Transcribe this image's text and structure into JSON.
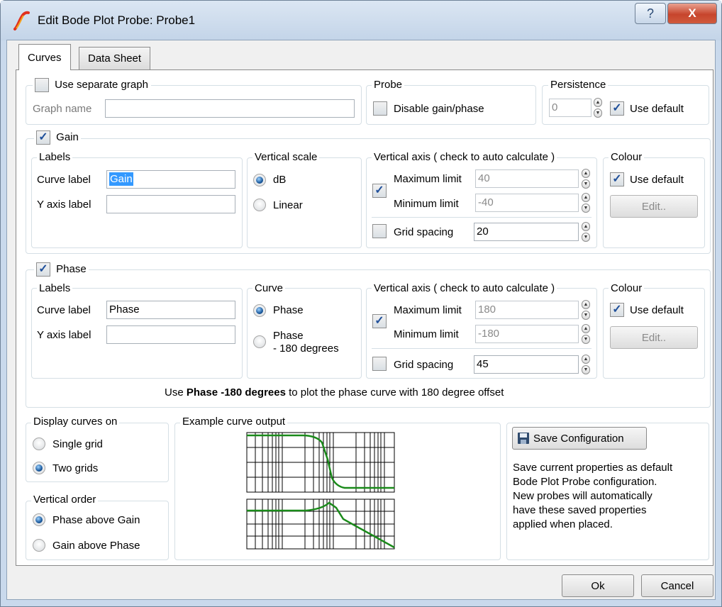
{
  "window": {
    "title": "Edit Bode Plot Probe: Probe1",
    "help_glyph": "?",
    "close_glyph": "X"
  },
  "tabs": [
    {
      "label": "Curves"
    },
    {
      "label": "Data Sheet"
    }
  ],
  "top": {
    "separate_graph": {
      "label": "Use separate graph",
      "checked": false
    },
    "graph_name": {
      "label": "Graph name",
      "value": ""
    },
    "probe": {
      "legend": "Probe",
      "disable_label": "Disable gain/phase",
      "checked": false
    },
    "persistence": {
      "legend": "Persistence",
      "value": "0",
      "use_default_label": "Use default",
      "use_default_checked": true
    }
  },
  "gain": {
    "legend": "Gain",
    "checked": true,
    "labels": {
      "legend": "Labels",
      "curve_label": "Curve label",
      "curve_value": "Gain",
      "y_axis_label": "Y axis label",
      "y_axis_value": ""
    },
    "vertical_scale": {
      "legend": "Vertical scale",
      "options": [
        "dB",
        "Linear"
      ],
      "selected": "dB"
    },
    "vertical_axis": {
      "legend": "Vertical axis ( check to auto calculate )",
      "auto": true,
      "max_label": "Maximum limit",
      "max_value": "40",
      "min_label": "Minimum limit",
      "min_value": "-40",
      "grid_label": "Grid spacing",
      "grid_checked": false,
      "grid_value": "20"
    },
    "colour": {
      "legend": "Colour",
      "use_default_label": "Use default",
      "checked": true,
      "edit_label": "Edit.."
    }
  },
  "phase": {
    "legend": "Phase",
    "checked": true,
    "labels": {
      "legend": "Labels",
      "curve_label": "Curve label",
      "curve_value": "Phase",
      "y_axis_label": "Y axis label",
      "y_axis_value": ""
    },
    "curve": {
      "legend": "Curve",
      "option1": "Phase",
      "option2_line1": "Phase",
      "option2_line2": "- 180 degrees",
      "selected": "Phase"
    },
    "vertical_axis": {
      "legend": "Vertical axis ( check to auto calculate )",
      "auto": true,
      "max_label": "Maximum limit",
      "max_value": "180",
      "min_label": "Minimum limit",
      "min_value": "-180",
      "grid_label": "Grid spacing",
      "grid_checked": false,
      "grid_value": "45"
    },
    "colour": {
      "legend": "Colour",
      "use_default_label": "Use default",
      "checked": true,
      "edit_label": "Edit.."
    }
  },
  "hint": {
    "prefix": "Use ",
    "bold": "Phase -180 degrees",
    "suffix": " to plot the phase curve with 180 degree offset"
  },
  "display": {
    "legend": "Display curves on",
    "options": [
      "Single grid",
      "Two grids"
    ],
    "selected": "Two grids"
  },
  "order": {
    "legend": "Vertical order",
    "options": [
      "Phase above Gain",
      "Gain above Phase"
    ],
    "selected": "Phase above Gain"
  },
  "example": {
    "legend": "Example curve output",
    "curve_color": "#1a8a1a"
  },
  "save": {
    "button_label": "Save Configuration",
    "description": [
      "Save current properties as default",
      "Bode Plot Probe configuration.",
      "New probes will automatically",
      "have these saved properties",
      "applied when placed."
    ]
  },
  "footer": {
    "ok": "Ok",
    "cancel": "Cancel"
  }
}
